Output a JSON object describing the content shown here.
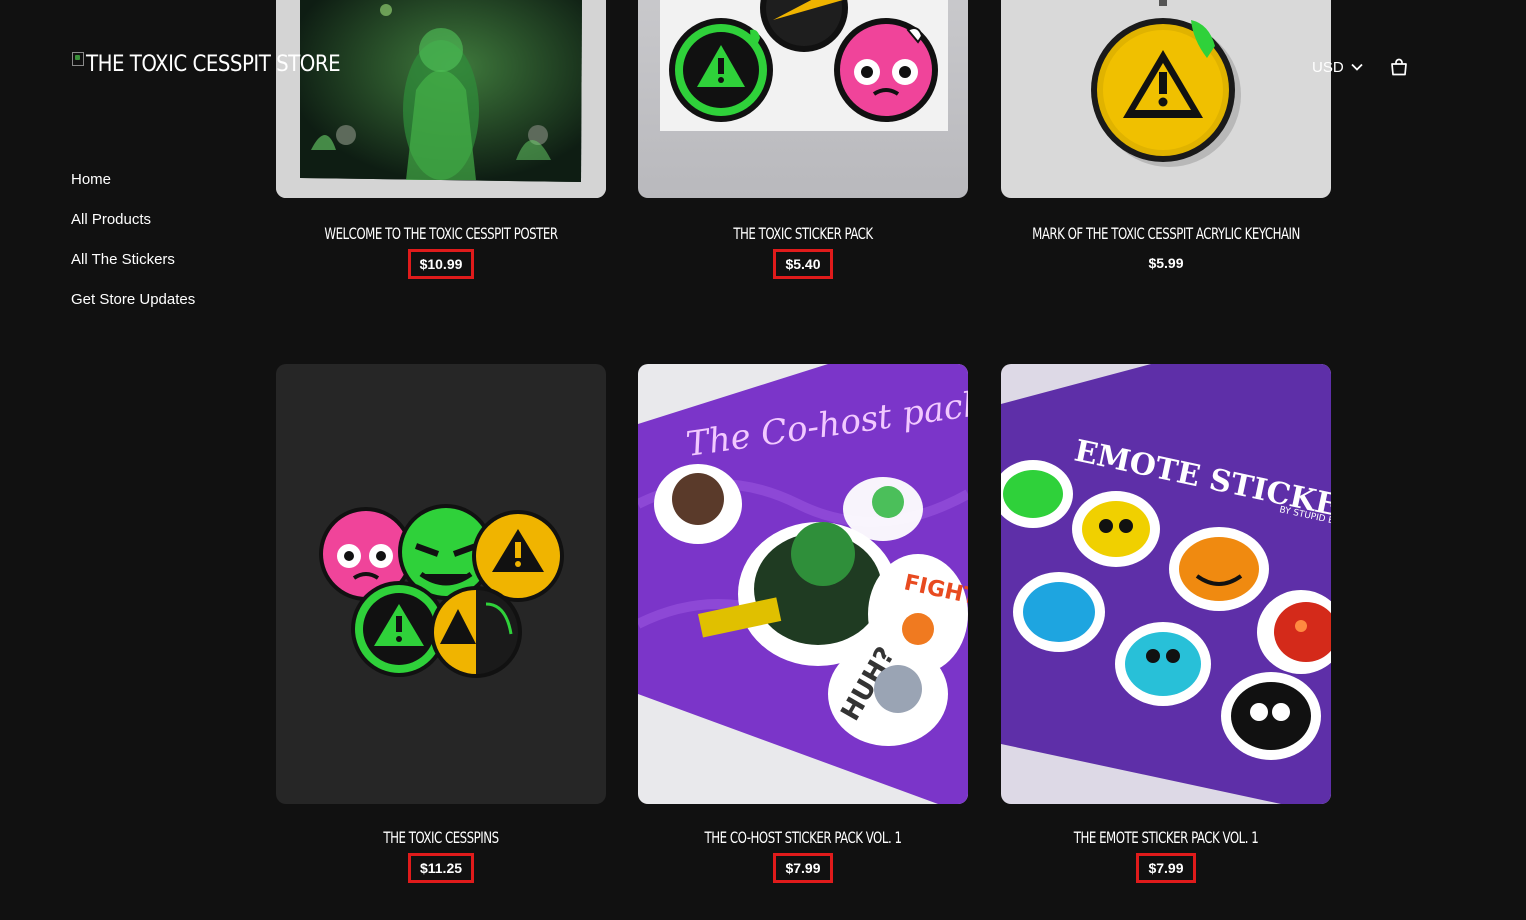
{
  "store": {
    "logo_alt_text": "THE TOXIC CESSPIT STORE"
  },
  "nav": {
    "items": [
      {
        "label": "Home"
      },
      {
        "label": "All Products"
      },
      {
        "label": "All The Stickers"
      },
      {
        "label": "Get Store Updates"
      }
    ]
  },
  "header": {
    "currency": "USD",
    "icons": {
      "currency_dropdown": "chevron-down-icon",
      "cart": "shopping-bag-icon"
    }
  },
  "products": [
    {
      "title": "WELCOME TO THE TOXIC CESSPIT POSTER",
      "price": "$10.99",
      "highlighted": true
    },
    {
      "title": "THE TOXIC STICKER PACK",
      "price": "$5.40",
      "highlighted": true
    },
    {
      "title": "MARK OF THE TOXIC CESSPIT ACRYLIC KEYCHAIN",
      "price": "$5.99",
      "highlighted": false
    },
    {
      "title": "THE TOXIC CESSPINS",
      "price": "$11.25",
      "highlighted": true
    },
    {
      "title": "THE CO-HOST STICKER PACK VOL. 1",
      "price": "$7.99",
      "highlighted": true
    },
    {
      "title": "THE EMOTE STICKER PACK VOL. 1",
      "price": "$7.99",
      "highlighted": true
    }
  ],
  "image_text": {
    "cohost_heading": "The Co-host pack",
    "cohost_fight": "FIGHT",
    "cohost_huh": "HUH?",
    "emote_heading": "EMOTE STICKERS!",
    "emote_byline": "BY STUPID BUTTERF"
  },
  "colors": {
    "background": "#111111",
    "highlight_border": "#e01b1b",
    "toxic_green": "#2fd13a",
    "warning_yellow": "#f0b400",
    "pink": "#f0449a",
    "purple": "#7b35c9"
  }
}
